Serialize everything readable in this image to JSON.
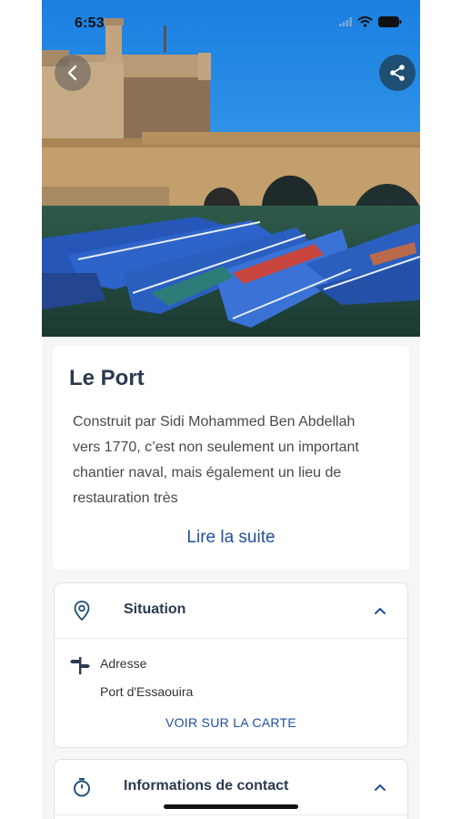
{
  "status_bar": {
    "time": "6:53"
  },
  "hero": {
    "photo_description_icon": "harbor-photo",
    "back_icon": "chevron-left-icon",
    "share_icon": "share-icon"
  },
  "place": {
    "title": "Le Port",
    "description": "Construit par Sidi Mohammed Ben Abdellah vers 1770, c’est non seulement un important chantier naval, mais également un lieu de restauration très",
    "read_more": "Lire la suite"
  },
  "situation": {
    "title": "Situation",
    "address_label": "Adresse",
    "address_value": "Port d'Essaouira",
    "map_link": "VOIR SUR LA CARTE"
  },
  "contact": {
    "title": "Informations de contact"
  },
  "colors": {
    "accent": "#1f4f9a",
    "share_button": "#1f4f73",
    "title_text": "#2b3a4f"
  }
}
